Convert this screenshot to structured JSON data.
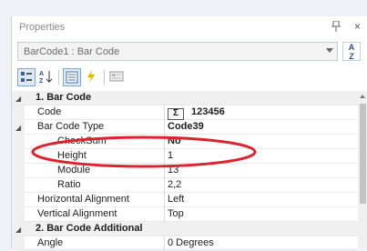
{
  "panel": {
    "title": "Properties",
    "pin_icon": "pin-icon",
    "close_label": "×"
  },
  "object_selector": {
    "value": "BarCode1 : Bar Code"
  },
  "sort_button": {
    "top": "A",
    "bottom": "Z"
  },
  "toolbar": {
    "items": [
      "categorized-icon",
      "alphabetical-icon",
      "properties-icon",
      "events-icon",
      "property-pages-icon"
    ]
  },
  "grid": {
    "cat1": {
      "label": "1. Bar  Code"
    },
    "code": {
      "name": "Code",
      "sigma": "Σ",
      "value": "123456"
    },
    "type": {
      "name": "Bar Code Type",
      "value": "Code39"
    },
    "checksum": {
      "name": "CheckSum",
      "value": "No"
    },
    "height": {
      "name": "Height",
      "value": "1"
    },
    "module": {
      "name": "Module",
      "value": "13"
    },
    "ratio": {
      "name": "Ratio",
      "value": "2,2"
    },
    "halign": {
      "name": "Horizontal Alignment",
      "value": "Left"
    },
    "valign": {
      "name": "Vertical Alignment",
      "value": "Top"
    },
    "cat2": {
      "label": "2. Bar  Code  Additional"
    },
    "angle": {
      "name": "Angle",
      "value": "0 Degrees"
    }
  },
  "colors": {
    "highlight_oval": "#e0202a",
    "toolbar_active": "#dce9f8"
  }
}
